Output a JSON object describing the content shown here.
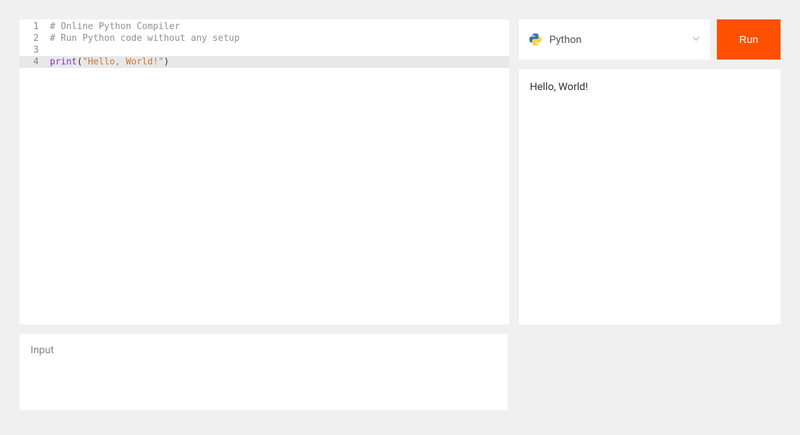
{
  "editor": {
    "lines": [
      {
        "n": 1,
        "active": false,
        "tokens": [
          {
            "cls": "tok-comment",
            "text": "# Online Python Compiler"
          }
        ]
      },
      {
        "n": 2,
        "active": false,
        "tokens": [
          {
            "cls": "tok-comment",
            "text": "# Run Python code without any setup"
          }
        ]
      },
      {
        "n": 3,
        "active": false,
        "tokens": []
      },
      {
        "n": 4,
        "active": true,
        "tokens": [
          {
            "cls": "tok-builtin",
            "text": "print"
          },
          {
            "cls": "tok-paren",
            "text": "("
          },
          {
            "cls": "tok-string",
            "text": "\"Hello, World!\""
          },
          {
            "cls": "tok-paren",
            "text": ")"
          }
        ]
      }
    ]
  },
  "language": {
    "name": "Python",
    "icon": "python-icon"
  },
  "run_label": "Run",
  "output": "Hello, World!",
  "input_label": "Input"
}
